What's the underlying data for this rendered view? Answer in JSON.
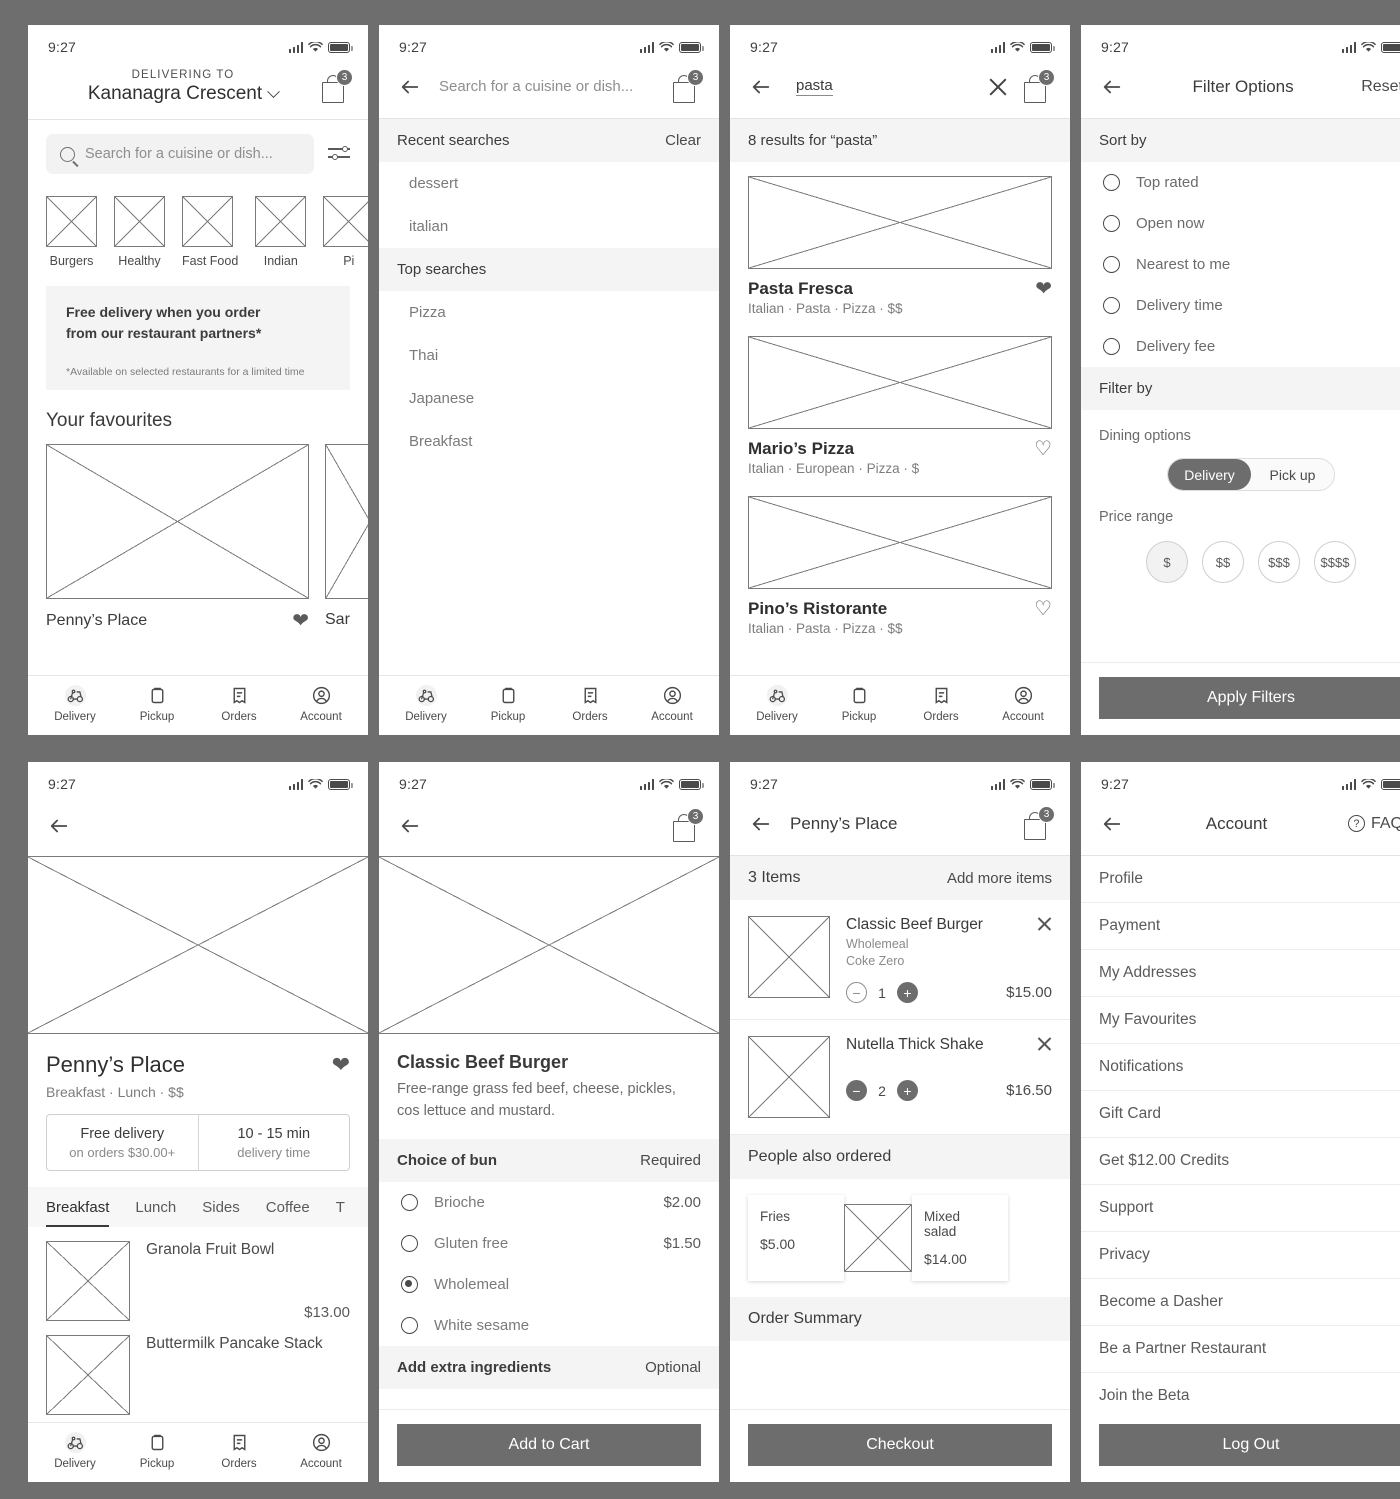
{
  "status": {
    "time": "9:27",
    "signal_icon": "cellular-bars-icon",
    "wifi_icon": "wifi-icon",
    "battery_icon": "battery-icon"
  },
  "cart_badge": "3",
  "nav": {
    "items": [
      {
        "label": "Delivery",
        "icon": "scooter-icon",
        "active": true
      },
      {
        "label": "Pickup",
        "icon": "bag-icon",
        "active": false
      },
      {
        "label": "Orders",
        "icon": "receipt-icon",
        "active": false
      },
      {
        "label": "Account",
        "icon": "account-circle-icon",
        "active": false
      }
    ]
  },
  "screen_home": {
    "delivering_to_label": "DELIVERING TO",
    "address": "Kananagra Crescent",
    "search_placeholder": "Search for a cuisine or dish...",
    "categories": [
      {
        "label": "Burgers"
      },
      {
        "label": "Healthy"
      },
      {
        "label": "Fast Food"
      },
      {
        "label": "Indian"
      },
      {
        "label": "Pi"
      }
    ],
    "promo_line1": "Free delivery when you order",
    "promo_line2": "from our restaurant partners*",
    "promo_fineprint": "*Available on selected restaurants for a limited time",
    "favourites_title": "Your favourites",
    "favourites": [
      {
        "name": "Penny’s Place",
        "favourite": true
      },
      {
        "name": "Sar",
        "favourite": false
      }
    ]
  },
  "screen_search": {
    "search_placeholder": "Search for a cuisine or dish...",
    "recent_title": "Recent searches",
    "clear_label": "Clear",
    "recent": [
      "dessert",
      "italian"
    ],
    "top_title": "Top searches",
    "top": [
      "Pizza",
      "Thai",
      "Japanese",
      "Breakfast"
    ]
  },
  "screen_results": {
    "query": "pasta",
    "results_count_label": "8 results for “pasta”",
    "results": [
      {
        "name": "Pasta Fresca",
        "tags": "Italian · Pasta · Pizza · $$",
        "favourite": true
      },
      {
        "name": "Mario’s Pizza",
        "tags": "Italian · European · Pizza · $",
        "favourite": false
      },
      {
        "name": "Pino’s Ristorante",
        "tags": "Italian · Pasta · Pizza · $$",
        "favourite": false
      }
    ]
  },
  "screen_filters": {
    "title": "Filter Options",
    "reset_label": "Reset",
    "sort_by_title": "Sort by",
    "sort_options": [
      {
        "label": "Top rated",
        "selected": false
      },
      {
        "label": "Open now",
        "selected": false
      },
      {
        "label": "Nearest to me",
        "selected": false
      },
      {
        "label": "Delivery time",
        "selected": false
      },
      {
        "label": "Delivery fee",
        "selected": false
      }
    ],
    "filter_by_title": "Filter by",
    "dining_options_label": "Dining options",
    "dining_delivery": "Delivery",
    "dining_pickup": "Pick up",
    "price_range_label": "Price range",
    "price_options": [
      {
        "label": "$",
        "selected": true
      },
      {
        "label": "$$",
        "selected": false
      },
      {
        "label": "$$$",
        "selected": false
      },
      {
        "label": "$$$$",
        "selected": false
      }
    ],
    "apply_label": "Apply Filters"
  },
  "screen_restaurant": {
    "name": "Penny’s Place",
    "tags": "Breakfast · Lunch · $$",
    "favourite": true,
    "delivery_title": "Free delivery",
    "delivery_sub": "on orders $30.00+",
    "time_title": "10 - 15 min",
    "time_sub": "delivery time",
    "tabs": [
      {
        "label": "Breakfast",
        "active": true
      },
      {
        "label": "Lunch",
        "active": false
      },
      {
        "label": "Sides",
        "active": false
      },
      {
        "label": "Coffee",
        "active": false
      },
      {
        "label": "T",
        "active": false
      }
    ],
    "menu": [
      {
        "name": "Granola Fruit Bowl",
        "price": "$13.00"
      },
      {
        "name": "Buttermilk Pancake Stack",
        "price": ""
      }
    ]
  },
  "screen_item": {
    "title": "Classic Beef Burger",
    "description": "Free-range grass fed beef, cheese, pickles, cos lettuce and mustard.",
    "bun_section_title": "Choice of bun",
    "bun_section_badge": "Required",
    "bun_options": [
      {
        "label": "Brioche",
        "price": "$2.00",
        "selected": false
      },
      {
        "label": "Gluten free",
        "price": "$1.50",
        "selected": false
      },
      {
        "label": "Wholemeal",
        "price": "",
        "selected": true
      },
      {
        "label": "White sesame",
        "price": "",
        "selected": false
      }
    ],
    "extras_title": "Add extra ingredients",
    "extras_badge": "Optional",
    "add_to_cart_label": "Add to Cart"
  },
  "screen_cart": {
    "title": "Penny’s Place",
    "items_count_label": "3 Items",
    "add_more_label": "Add more items",
    "items": [
      {
        "name": "Classic Beef Burger",
        "options": [
          "Wholemeal",
          "Coke Zero"
        ],
        "qty": "1",
        "price": "$15.00",
        "minus_enabled": false
      },
      {
        "name": "Nutella Thick Shake",
        "options": [],
        "qty": "2",
        "price": "$16.50",
        "minus_enabled": true
      }
    ],
    "also_title": "People also ordered",
    "also_items": [
      {
        "name": "Fries",
        "price": "$5.00"
      },
      {
        "name": "Mixed salad",
        "price": "$14.00"
      }
    ],
    "summary_title": "Order Summary",
    "checkout_label": "Checkout"
  },
  "screen_account": {
    "title": "Account",
    "faq_label": "FAQ",
    "items": [
      "Profile",
      "Payment",
      "My Addresses",
      "My Favourites",
      "Notifications",
      "Gift Card",
      "Get $12.00 Credits",
      "Support",
      "Privacy",
      "Become a Dasher",
      "Be a Partner Restaurant",
      "Join the Beta"
    ],
    "logout_label": "Log Out"
  }
}
